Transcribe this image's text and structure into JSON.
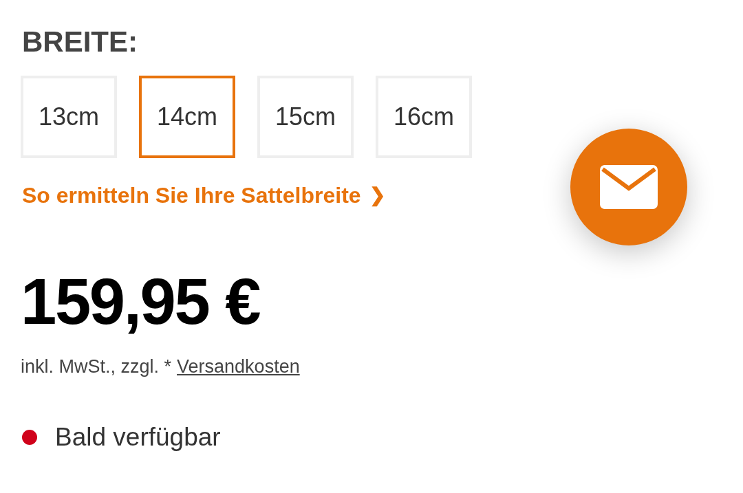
{
  "width_label": "BREITE:",
  "sizes": [
    {
      "label": "13cm",
      "selected": false
    },
    {
      "label": "14cm",
      "selected": true
    },
    {
      "label": "15cm",
      "selected": false
    },
    {
      "label": "16cm",
      "selected": false
    }
  ],
  "guide_link": {
    "label": "So ermitteln Sie Ihre Sattelbreite",
    "chevron": "❯"
  },
  "price": "159,95 €",
  "tax_note": {
    "text": "inkl. MwSt., zzgl. *",
    "link": "Versandkosten"
  },
  "availability": {
    "label": "Bald verfügbar",
    "color": "#d0021b"
  },
  "contact_button": {
    "kind": "mail"
  }
}
